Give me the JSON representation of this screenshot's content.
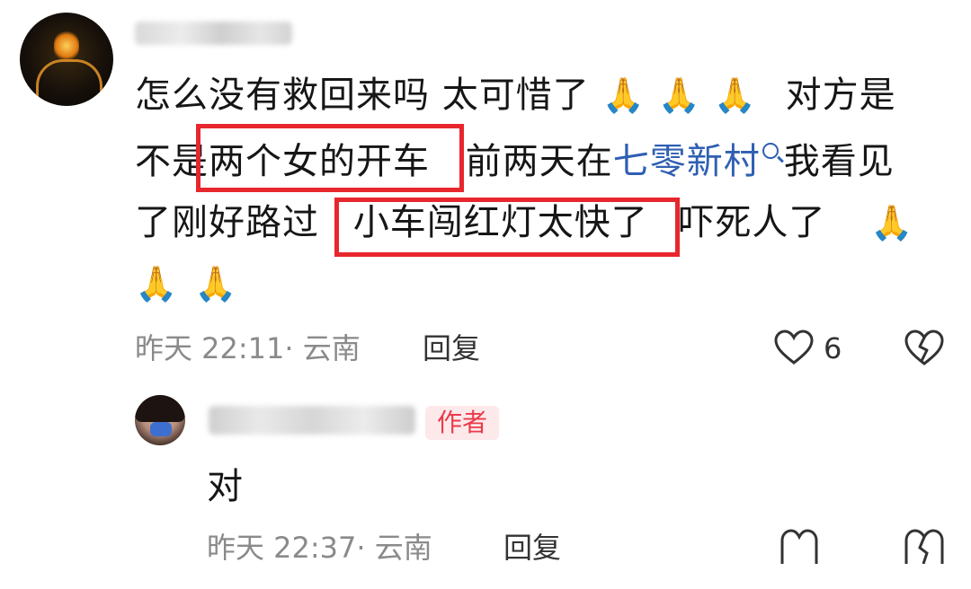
{
  "comment": {
    "text": {
      "line1": "怎么没有救回来吗  太可惜了",
      "line1_tail": "对方是",
      "line2_pre": "不是",
      "line2_box": "两个女的开车",
      "line2_mid": "前两天在",
      "line2_link": "七零新村",
      "line2_post": "我看见",
      "line3_pre": "了刚好路过",
      "line3_box": "小车闯红灯太快了",
      "line3_post": "吓死人了"
    },
    "emoji": "🙏",
    "meta": "昨天 22:11· 云南",
    "reply_label": "回复",
    "like_count": "6"
  },
  "reply_comment": {
    "author_badge": "作者",
    "text": "对",
    "meta": "昨天 22:37· 云南",
    "reply_label": "回复"
  },
  "colors": {
    "highlight_box": "#e8262d",
    "link": "#2f5fb3",
    "meta_text": "#8a8a8a",
    "badge_text": "#e83b4b",
    "badge_bg": "#fde8ea"
  },
  "icons": [
    "heart-outline-icon",
    "broken-heart-icon",
    "search-icon",
    "praying-hands-emoji"
  ]
}
